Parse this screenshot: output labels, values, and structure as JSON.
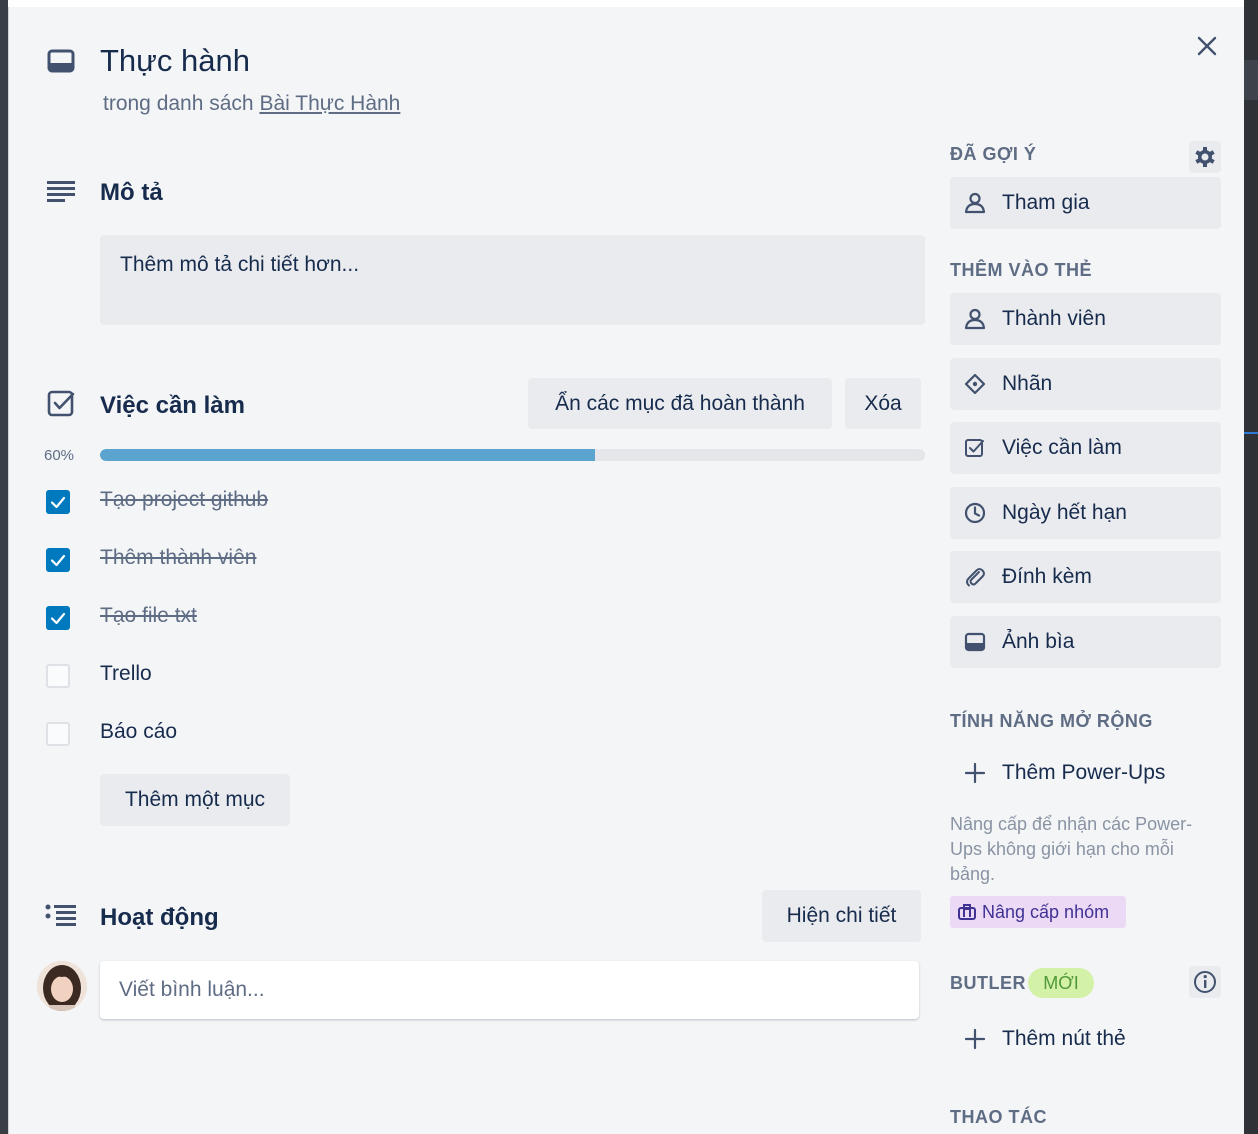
{
  "card": {
    "title": "Thực hành",
    "list_prefix": "trong danh sách",
    "list_name": "Bài Thực Hành"
  },
  "description": {
    "heading": "Mô tả",
    "placeholder": "Thêm mô tả chi tiết hơn..."
  },
  "checklist": {
    "heading": "Việc cần làm",
    "hide_completed_label": "Ẩn các mục đã hoàn thành",
    "delete_label": "Xóa",
    "progress_label": "60%",
    "progress_value": 60,
    "items": [
      {
        "text": "Tạo project github",
        "done": true
      },
      {
        "text": "Thêm thành viên",
        "done": true
      },
      {
        "text": "Tạo file txt",
        "done": true
      },
      {
        "text": "Trello",
        "done": false
      },
      {
        "text": "Báo cáo",
        "done": false
      }
    ],
    "add_item_label": "Thêm một mục"
  },
  "activity": {
    "heading": "Hoạt động",
    "show_details_label": "Hiện chi tiết",
    "comment_placeholder": "Viết bình luận..."
  },
  "sidebar": {
    "suggested_label": "ĐÃ GỢI Ý",
    "join_label": "Tham gia",
    "add_to_card_label": "THÊM VÀO THẺ",
    "add_to_card_items": [
      {
        "label": "Thành viên",
        "icon": "member-icon"
      },
      {
        "label": "Nhãn",
        "icon": "label-icon"
      },
      {
        "label": "Việc cần làm",
        "icon": "checklist-icon"
      },
      {
        "label": "Ngày hết hạn",
        "icon": "clock-icon"
      },
      {
        "label": "Đính kèm",
        "icon": "paperclip-icon"
      },
      {
        "label": "Ảnh bìa",
        "icon": "cover-icon"
      }
    ],
    "powerups_label": "TÍNH NĂNG MỞ RỘNG",
    "add_powerups_label": "Thêm Power-Ups",
    "upgrade_text": "Nâng cấp để nhận các Power-Ups không giới hạn cho mỗi bảng.",
    "upgrade_team_label": "Nâng cấp nhóm",
    "butler_label": "BUTLER",
    "new_badge": "MỚI",
    "add_card_button_label": "Thêm nút thẻ",
    "actions_label": "THAO TÁC"
  },
  "colors": {
    "accent": "#0079bf",
    "progress": "#5ba4cf",
    "button_bg": "#e9ebee",
    "modal_bg": "#f4f5f7"
  }
}
